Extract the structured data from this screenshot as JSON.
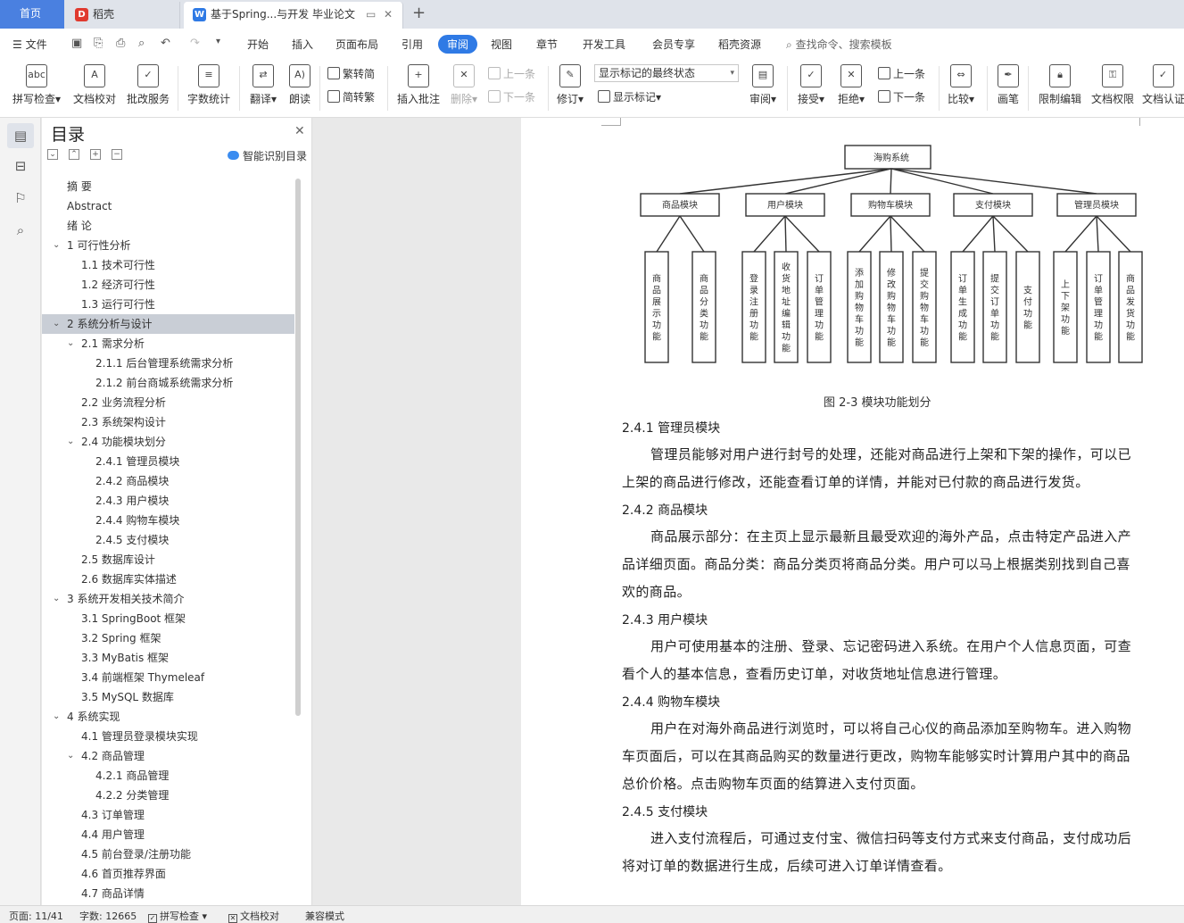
{
  "tabs": {
    "home": "首页",
    "daoke": "稻壳",
    "document": "基于Spring...与开发 毕业论文"
  },
  "menu": {
    "file": "文件",
    "items": [
      "开始",
      "插入",
      "页面布局",
      "引用",
      "审阅",
      "视图",
      "章节",
      "开发工具",
      "会员专享",
      "稻壳资源"
    ],
    "active": "审阅",
    "search_placeholder": "查找命令、搜索模板"
  },
  "ribbon": {
    "spell_check": "拼写检查",
    "doc_proofread": "文档校对",
    "correction_service": "批改服务",
    "word_count": "字数统计",
    "translate": "翻译",
    "read_aloud": "朗读",
    "trad_to_simp": "繁转简",
    "simp_to_trad": "简转繁",
    "insert_comment": "插入批注",
    "delete": "删除",
    "prev_comment": "上一条",
    "next_comment": "下一条",
    "track_changes": "修订",
    "markup_state": "显示标记的最终状态",
    "show_markup": "显示标记",
    "review": "审阅",
    "accept": "接受",
    "reject": "拒绝",
    "prev_change": "上一条",
    "next_change": "下一条",
    "compare": "比较",
    "ink": "画笔",
    "restrict_edit": "限制编辑",
    "doc_permission": "文档权限",
    "doc_certify": "文档认证"
  },
  "nav": {
    "title": "目录",
    "smart_toc": "智能识别目录",
    "items": [
      {
        "label": "摘  要",
        "level": 0,
        "arrow": ""
      },
      {
        "label": "Abstract",
        "level": 0,
        "arrow": ""
      },
      {
        "label": "绪  论",
        "level": 0,
        "arrow": ""
      },
      {
        "label": "1  可行性分析",
        "level": 0,
        "arrow": "v"
      },
      {
        "label": "1.1  技术可行性",
        "level": 1,
        "arrow": ""
      },
      {
        "label": "1.2  经济可行性",
        "level": 1,
        "arrow": ""
      },
      {
        "label": "1.3  运行可行性",
        "level": 1,
        "arrow": ""
      },
      {
        "label": "2  系统分析与设计",
        "level": 0,
        "arrow": "v",
        "selected": true
      },
      {
        "label": "2.1  需求分析",
        "level": 1,
        "arrow": "v"
      },
      {
        "label": "2.1.1  后台管理系统需求分析",
        "level": 2,
        "arrow": ""
      },
      {
        "label": "2.1.2  前台商城系统需求分析",
        "level": 2,
        "arrow": ""
      },
      {
        "label": "2.2  业务流程分析",
        "level": 1,
        "arrow": ""
      },
      {
        "label": "2.3  系统架构设计",
        "level": 1,
        "arrow": ""
      },
      {
        "label": "2.4  功能模块划分",
        "level": 1,
        "arrow": "v"
      },
      {
        "label": "2.4.1  管理员模块",
        "level": 2,
        "arrow": ""
      },
      {
        "label": "2.4.2  商品模块",
        "level": 2,
        "arrow": ""
      },
      {
        "label": "2.4.3  用户模块",
        "level": 2,
        "arrow": ""
      },
      {
        "label": "2.4.4  购物车模块",
        "level": 2,
        "arrow": ""
      },
      {
        "label": "2.4.5  支付模块",
        "level": 2,
        "arrow": ""
      },
      {
        "label": "2.5  数据库设计",
        "level": 1,
        "arrow": ""
      },
      {
        "label": "2.6  数据库实体描述",
        "level": 1,
        "arrow": ""
      },
      {
        "label": "3  系统开发相关技术简介",
        "level": 0,
        "arrow": "v"
      },
      {
        "label": "3.1 SpringBoot 框架",
        "level": 1,
        "arrow": ""
      },
      {
        "label": "3.2 Spring 框架",
        "level": 1,
        "arrow": ""
      },
      {
        "label": "3.3 MyBatis 框架",
        "level": 1,
        "arrow": ""
      },
      {
        "label": "3.4  前端框架 Thymeleaf",
        "level": 1,
        "arrow": ""
      },
      {
        "label": "3.5 MySQL 数据库",
        "level": 1,
        "arrow": ""
      },
      {
        "label": "4  系统实现",
        "level": 0,
        "arrow": "v"
      },
      {
        "label": "4.1  管理员登录模块实现",
        "level": 1,
        "arrow": ""
      },
      {
        "label": "4.2  商品管理",
        "level": 1,
        "arrow": "v"
      },
      {
        "label": "4.2.1  商品管理",
        "level": 2,
        "arrow": ""
      },
      {
        "label": "4.2.2  分类管理",
        "level": 2,
        "arrow": ""
      },
      {
        "label": "4.3  订单管理",
        "level": 1,
        "arrow": ""
      },
      {
        "label": "4.4  用户管理",
        "level": 1,
        "arrow": ""
      },
      {
        "label": "4.5  前台登录/注册功能",
        "level": 1,
        "arrow": ""
      },
      {
        "label": "4.6  首页推荐界面",
        "level": 1,
        "arrow": ""
      },
      {
        "label": "4.7  商品详情",
        "level": 1,
        "arrow": ""
      }
    ]
  },
  "diagram": {
    "root": "海购系统",
    "modules": [
      {
        "name": "商品模块",
        "leaves": [
          "商品展示功能",
          "商品分类功能"
        ]
      },
      {
        "name": "用户模块",
        "leaves": [
          "登录注册功能",
          "收货地址编辑功能",
          "订单管理功能"
        ]
      },
      {
        "name": "购物车模块",
        "leaves": [
          "添加购物车功能",
          "修改购物车功能",
          "提交购物车功能"
        ]
      },
      {
        "name": "支付模块",
        "leaves": [
          "订单生成功能",
          "提交订单功能",
          "支付功能"
        ]
      },
      {
        "name": "管理员模块",
        "leaves": [
          "上下架功能",
          "订单管理功能",
          "商品发货功能"
        ]
      }
    ]
  },
  "doc": {
    "caption": "图 2-3  模块功能划分",
    "sections": [
      {
        "heading": "2.4.1  管理员模块",
        "text": "管理员能够对用户进行封号的处理，还能对商品进行上架和下架的操作，可以已上架的商品进行修改，还能查看订单的详情，并能对已付款的商品进行发货。"
      },
      {
        "heading": "2.4.2  商品模块",
        "text": "商品展示部分：在主页上显示最新且最受欢迎的海外产品，点击特定产品进入产品详细页面。商品分类：商品分类页将商品分类。用户可以马上根据类别找到自己喜欢的商品。"
      },
      {
        "heading": "2.4.3  用户模块",
        "text": "用户可使用基本的注册、登录、忘记密码进入系统。在用户个人信息页面，可查看个人的基本信息，查看历史订单，对收货地址信息进行管理。"
      },
      {
        "heading": "2.4.4  购物车模块",
        "text": "用户在对海外商品进行浏览时，可以将自己心仪的商品添加至购物车。进入购物车页面后，可以在其商品购买的数量进行更改，购物车能够实时计算用户其中的商品总价价格。点击购物车页面的结算进入支付页面。"
      },
      {
        "heading": "2.4.5  支付模块",
        "text": "进入支付流程后，可通过支付宝、微信扫码等支付方式来支付商品，支付成功后将对订单的数据进行生成，后续可进入订单详情查看。"
      }
    ]
  },
  "status": {
    "page": "页面: 11/41",
    "words": "字数: 12665",
    "spell": "拼写检查",
    "proof": "文档校对",
    "compat": "兼容模式"
  }
}
